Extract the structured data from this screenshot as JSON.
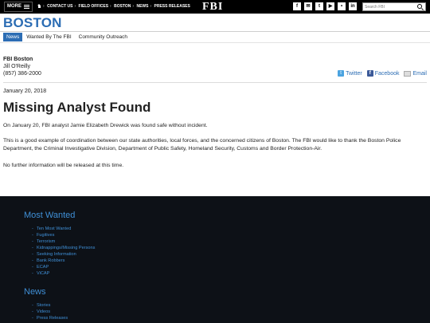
{
  "topbar": {
    "more_label": "MORE",
    "breadcrumbs": [
      "CONTACT US",
      "FIELD OFFICES",
      "BOSTON",
      "NEWS",
      "PRESS RELEASES"
    ],
    "logo": "FBI",
    "social_icons": [
      "facebook-icon",
      "email-icon",
      "twitter-icon",
      "youtube-icon",
      "flickr-icon",
      "linkedin-icon"
    ],
    "search_placeholder": "Search FBI"
  },
  "header": {
    "title": "BOSTON",
    "tabs": [
      {
        "label": "News",
        "active": true
      },
      {
        "label": "Wanted By The FBI",
        "active": false
      },
      {
        "label": "Community Outreach",
        "active": false
      }
    ]
  },
  "contact": {
    "office": "FBI Boston",
    "name": "Jill O'Reilly",
    "phone": "(857) 386-2000",
    "share": {
      "twitter": "Twitter",
      "facebook": "Facebook",
      "email": "Email"
    }
  },
  "article": {
    "date": "January 20, 2018",
    "title": "Missing Analyst Found",
    "paragraphs": [
      "On January 20, FBI analyst Jamie Elizabeth Drewick was found safe without incident.",
      "This is a good example of coordination between our state authorities, local forces, and the concerned citizens of Boston. The FBI would like to thank the Boston Police Department, the Criminal Investigative Division, Department of Public Safety, Homeland Security, Customs and Border Protection-Air.",
      "No further information will be released at this time."
    ]
  },
  "footer": {
    "most_wanted": {
      "heading": "Most Wanted",
      "items": [
        "Ten Most Wanted",
        "Fugitives",
        "Terrorism",
        "Kidnappings/Missing Persons",
        "Seeking Information",
        "Bank Robbers",
        "ECAP",
        "ViCAP"
      ]
    },
    "news": {
      "heading": "News",
      "items": [
        "Stories",
        "Videos",
        "Press Releases"
      ]
    }
  },
  "colors": {
    "accent": "#2c6db4",
    "footer_bg": "#0d1117",
    "footer_link": "#3f8fd6"
  }
}
